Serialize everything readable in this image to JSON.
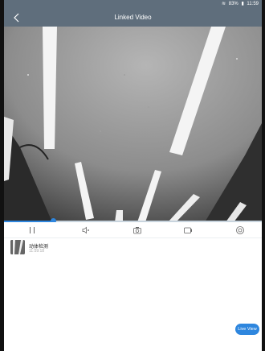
{
  "statusbar": {
    "battery": "83%",
    "time": "11:59"
  },
  "header": {
    "title": "Linked Video",
    "back_icon": "chevron-left-icon"
  },
  "playback": {
    "progress": 0.19
  },
  "controls": {
    "icons": [
      "pause-icon",
      "volume-icon",
      "camera-icon",
      "record-icon",
      "settings-icon"
    ]
  },
  "event": {
    "title": "动体检测",
    "time": "11:59:18"
  },
  "live_button": {
    "label": "Live View"
  },
  "colors": {
    "header": "#5f6e7c",
    "accent": "#2e86de"
  }
}
